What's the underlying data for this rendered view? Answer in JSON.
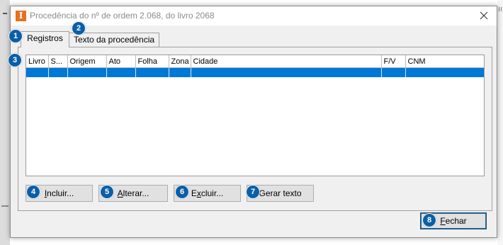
{
  "window": {
    "title": "Procedência do nº de ordem 2.068, do livro 2068",
    "icon_glyph": "I",
    "accent": "#e8701c"
  },
  "tabs": [
    {
      "label": "Registros",
      "active": true
    },
    {
      "label": "Texto da procedência",
      "active": false
    }
  ],
  "grid": {
    "columns": [
      "Livro",
      "S...",
      "Origem",
      "Ato",
      "Folha",
      "Zona",
      "Cidade",
      "F/V",
      "CNM"
    ],
    "selected_row_color": "#0078d7"
  },
  "buttons": {
    "incluir": {
      "mnemonic": "I",
      "rest": "ncluir..."
    },
    "alterar": {
      "mnemonic": "A",
      "rest": "lterar..."
    },
    "excluir": {
      "pre": "E",
      "mnemonic": "x",
      "rest": "cluir..."
    },
    "gerar_texto": {
      "label": "Gerar texto"
    },
    "fechar": {
      "mnemonic": "F",
      "rest": "echar"
    }
  },
  "badges": [
    "1",
    "2",
    "3",
    "4",
    "5",
    "6",
    "7",
    "8"
  ],
  "badge_color": "#0a5fa8"
}
